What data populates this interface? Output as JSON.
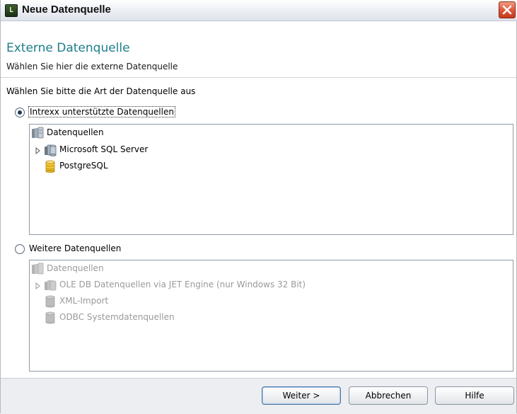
{
  "window": {
    "title": "Neue Datenquelle",
    "app_icon_text": "L"
  },
  "header": {
    "title": "Externe Datenquelle",
    "subtitle": "Wählen Sie hier die externe Datenquelle"
  },
  "prompt": "Wählen Sie bitte die Art der Datenquelle aus",
  "option_supported": {
    "label": "Intrexx unterstützte Datenquellen",
    "checked": true,
    "tree": [
      {
        "label": "Datenquellen",
        "icon": "database-group-icon",
        "level": 0,
        "expandable": false
      },
      {
        "label": "Microsoft SQL Server",
        "icon": "database-server-icon",
        "level": 1,
        "expandable": true
      },
      {
        "label": "PostgreSQL",
        "icon": "database-yellow-icon",
        "level": 1,
        "expandable": false
      }
    ]
  },
  "option_more": {
    "label": "Weitere Datenquellen",
    "checked": false,
    "tree": [
      {
        "label": "Datenquellen",
        "icon": "database-group-icon",
        "level": 0,
        "expandable": false
      },
      {
        "label": "OLE DB Datenquellen via JET Engine (nur Windows 32 Bit)",
        "icon": "database-server-icon",
        "level": 1,
        "expandable": true
      },
      {
        "label": "XML-Import",
        "icon": "database-icon",
        "level": 1,
        "expandable": false
      },
      {
        "label": "ODBC Systemdatenquellen",
        "icon": "database-icon",
        "level": 1,
        "expandable": false
      }
    ]
  },
  "buttons": {
    "next": "Weiter >",
    "cancel": "Abbrechen",
    "help": "Hilfe"
  },
  "colors": {
    "accent": "#1e7d8a",
    "close": "#e0583b",
    "disabled_text": "#9a9a9a"
  }
}
